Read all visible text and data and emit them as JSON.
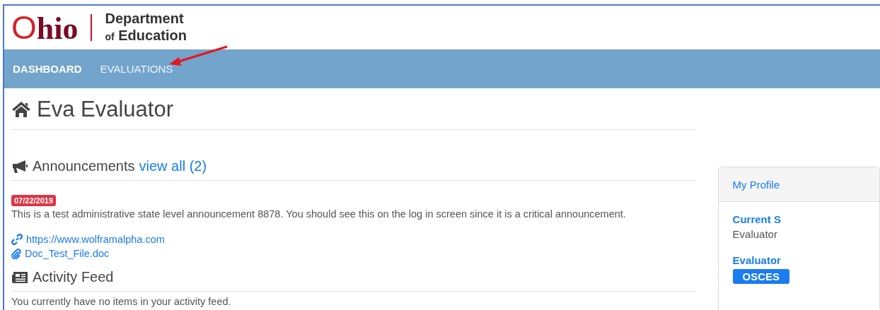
{
  "header": {
    "logo_word": "Ohio",
    "logo_line1": "Department",
    "logo_line2_small": "of",
    "logo_line2": "Education"
  },
  "nav": [
    {
      "label": "DASHBOARD",
      "selected": true
    },
    {
      "label": "EVALUATIONS",
      "selected": false
    }
  ],
  "page_title": "Eva Evaluator",
  "announcements": {
    "title": "Announcements",
    "view_all": "view all (2)",
    "items": [
      {
        "date": "07/22/2019",
        "text": "This is a test administrative state level announcement 8878. You should see this on the log in screen since it is a critical announcement.",
        "attachments": [
          {
            "kind": "link",
            "label": "https://www.wolframalpha.com"
          },
          {
            "kind": "file",
            "label": "Doc_Test_File.doc"
          }
        ]
      }
    ]
  },
  "activity_feed": {
    "title": "Activity Feed",
    "message": "You currently have no items in your activity feed."
  },
  "profile": {
    "header": "My Profile",
    "current_label": "Current S",
    "current_value": "Evaluator",
    "evaluator_label": "Evaluator",
    "evaluator_badge": "OSCES"
  }
}
